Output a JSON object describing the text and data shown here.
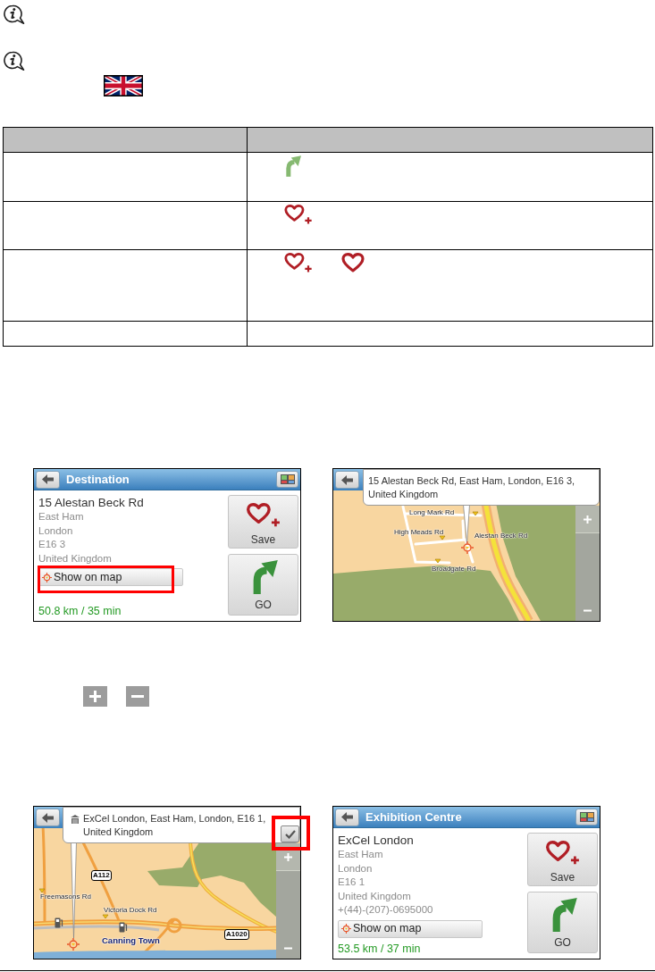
{
  "blocks": [
    {
      "kind": "note"
    },
    {
      "kind": "note"
    },
    {
      "kind": "flag"
    },
    {
      "kind": "table",
      "rows": [
        {
          "icons": [
            {
              "kind": "go"
            }
          ]
        },
        {
          "icons": [
            {
              "kind": "save"
            }
          ]
        },
        {
          "icons": [
            {
              "kind": "save"
            },
            {
              "kind": "favourite"
            }
          ]
        },
        {}
      ]
    },
    {
      "kind": "screens",
      "screens": [
        {
          "kind": "details",
          "title": "Destination",
          "name": "15 Alestan Beck Rd",
          "lines": [
            "East Ham",
            "London",
            "E16 3",
            "United Kingdom"
          ],
          "show_on_map": {
            "label": "Show on map",
            "highlighted": true
          },
          "distance": "50.8 km / 35 min",
          "save": "Save",
          "go": "GO"
        },
        {
          "kind": "map",
          "map": {
            "kind": "street"
          },
          "callout": "15 Alestan Beck Rd, East Ham, London, E16 3, United Kingdom",
          "labels": [
            {
              "kind": "street",
              "text": "Long Mark Rd"
            },
            {
              "kind": "street",
              "text": "High Meads Rd"
            },
            {
              "kind": "street",
              "text": "Alestan Beck Rd"
            },
            {
              "kind": "street",
              "text": "Broadgate Rd"
            }
          ]
        }
      ]
    },
    {
      "kind": "zoom_keys"
    },
    {
      "kind": "screens",
      "screens": [
        {
          "kind": "map",
          "map": {
            "kind": "district"
          },
          "venue": true,
          "callout": "ExCel London, East Ham, London, E16 1, United Kingdom",
          "confirm": {
            "highlighted": true
          },
          "labels": [
            {
              "kind": "shield",
              "text": "A112"
            },
            {
              "kind": "street",
              "text": "Freemasons Rd"
            },
            {
              "kind": "street",
              "text": "Victoria Dock Rd"
            },
            {
              "kind": "shield",
              "text": "A1020"
            },
            {
              "kind": "district",
              "text": "Canning Town"
            }
          ]
        },
        {
          "kind": "details",
          "title": "Exhibition Centre",
          "name": "ExCel London",
          "lines": [
            "East Ham",
            "London",
            "E16 1",
            "United Kingdom",
            "+(44)-(207)-0695000"
          ],
          "show_on_map": {
            "label": "Show on map",
            "highlighted": false
          },
          "distance": "53.5 km / 37 min",
          "save": "Save",
          "go": "GO"
        }
      ]
    }
  ]
}
